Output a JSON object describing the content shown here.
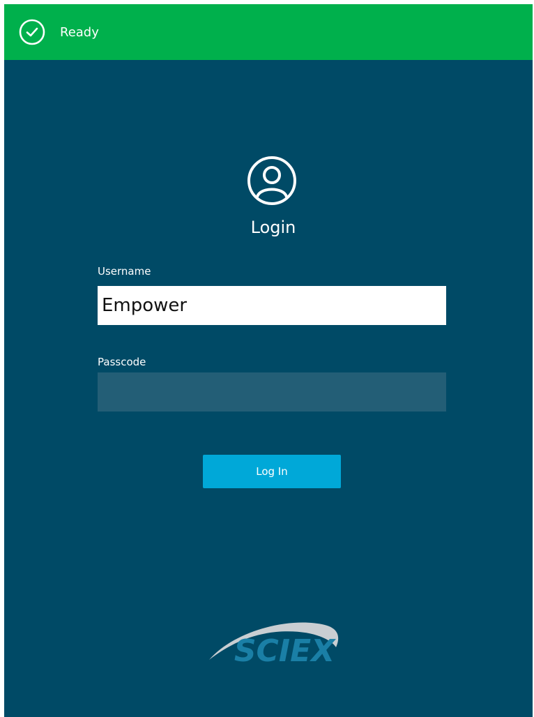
{
  "status": {
    "text": "Ready",
    "icon": "check-circle-icon",
    "color": "#00b04c"
  },
  "login": {
    "icon": "user-circle-icon",
    "title": "Login",
    "username_label": "Username",
    "username_value": "Empower",
    "passcode_label": "Passcode",
    "passcode_value": "",
    "button_label": "Log In"
  },
  "brand": {
    "logo_text": "SCIEX"
  },
  "colors": {
    "background": "#004a66",
    "button": "#00a8d8",
    "passcode_field": "#235e76",
    "logo": "#1a7fa6"
  }
}
